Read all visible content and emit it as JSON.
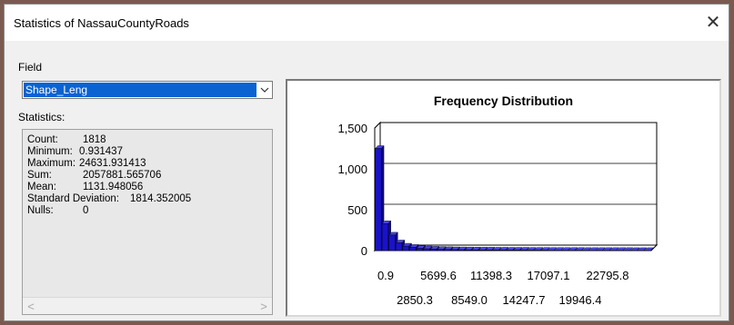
{
  "window": {
    "title": "Statistics of NassauCountyRoads",
    "close_glyph": "✕"
  },
  "field": {
    "label": "Field",
    "selected": "Shape_Leng"
  },
  "statistics": {
    "label": "Statistics:",
    "count_label": "Count:",
    "count_value": "1818",
    "minimum_label": "Minimum:",
    "minimum_value": "0.931437",
    "maximum_label": "Maximum:",
    "maximum_value": "24631.931413",
    "sum_label": "Sum:",
    "sum_value": "2057881.565706",
    "mean_label": "Mean:",
    "mean_value": "1131.948056",
    "stddev_label": "Standard Deviation:",
    "stddev_value": "1814.352005",
    "nulls_label": "Nulls:",
    "nulls_value": "0"
  },
  "chart_data": {
    "type": "bar",
    "title": "Frequency Distribution",
    "xlabel": "",
    "ylabel": "",
    "ylim": [
      0,
      1500
    ],
    "y_ticks": [
      0,
      500,
      1000,
      1500
    ],
    "y_tick_labels": [
      "0",
      "500",
      "1,000",
      "1,500"
    ],
    "x_tick_labels_row1": [
      "0.9",
      "5699.6",
      "11398.3",
      "17097.1",
      "22795.8"
    ],
    "x_tick_labels_row2": [
      "2850.3",
      "8549.0",
      "14247.7",
      "19946.4"
    ],
    "values": [
      1250,
      330,
      190,
      95,
      55,
      40,
      28,
      22,
      18,
      15,
      13,
      11,
      10,
      9,
      8,
      7,
      7,
      6,
      6,
      5,
      5,
      5,
      4,
      4,
      4,
      3,
      3,
      3,
      3,
      3,
      2,
      2,
      2,
      2,
      2,
      2,
      2,
      1,
      1,
      1
    ],
    "bar_color": "#1a12c8",
    "grid": true
  }
}
